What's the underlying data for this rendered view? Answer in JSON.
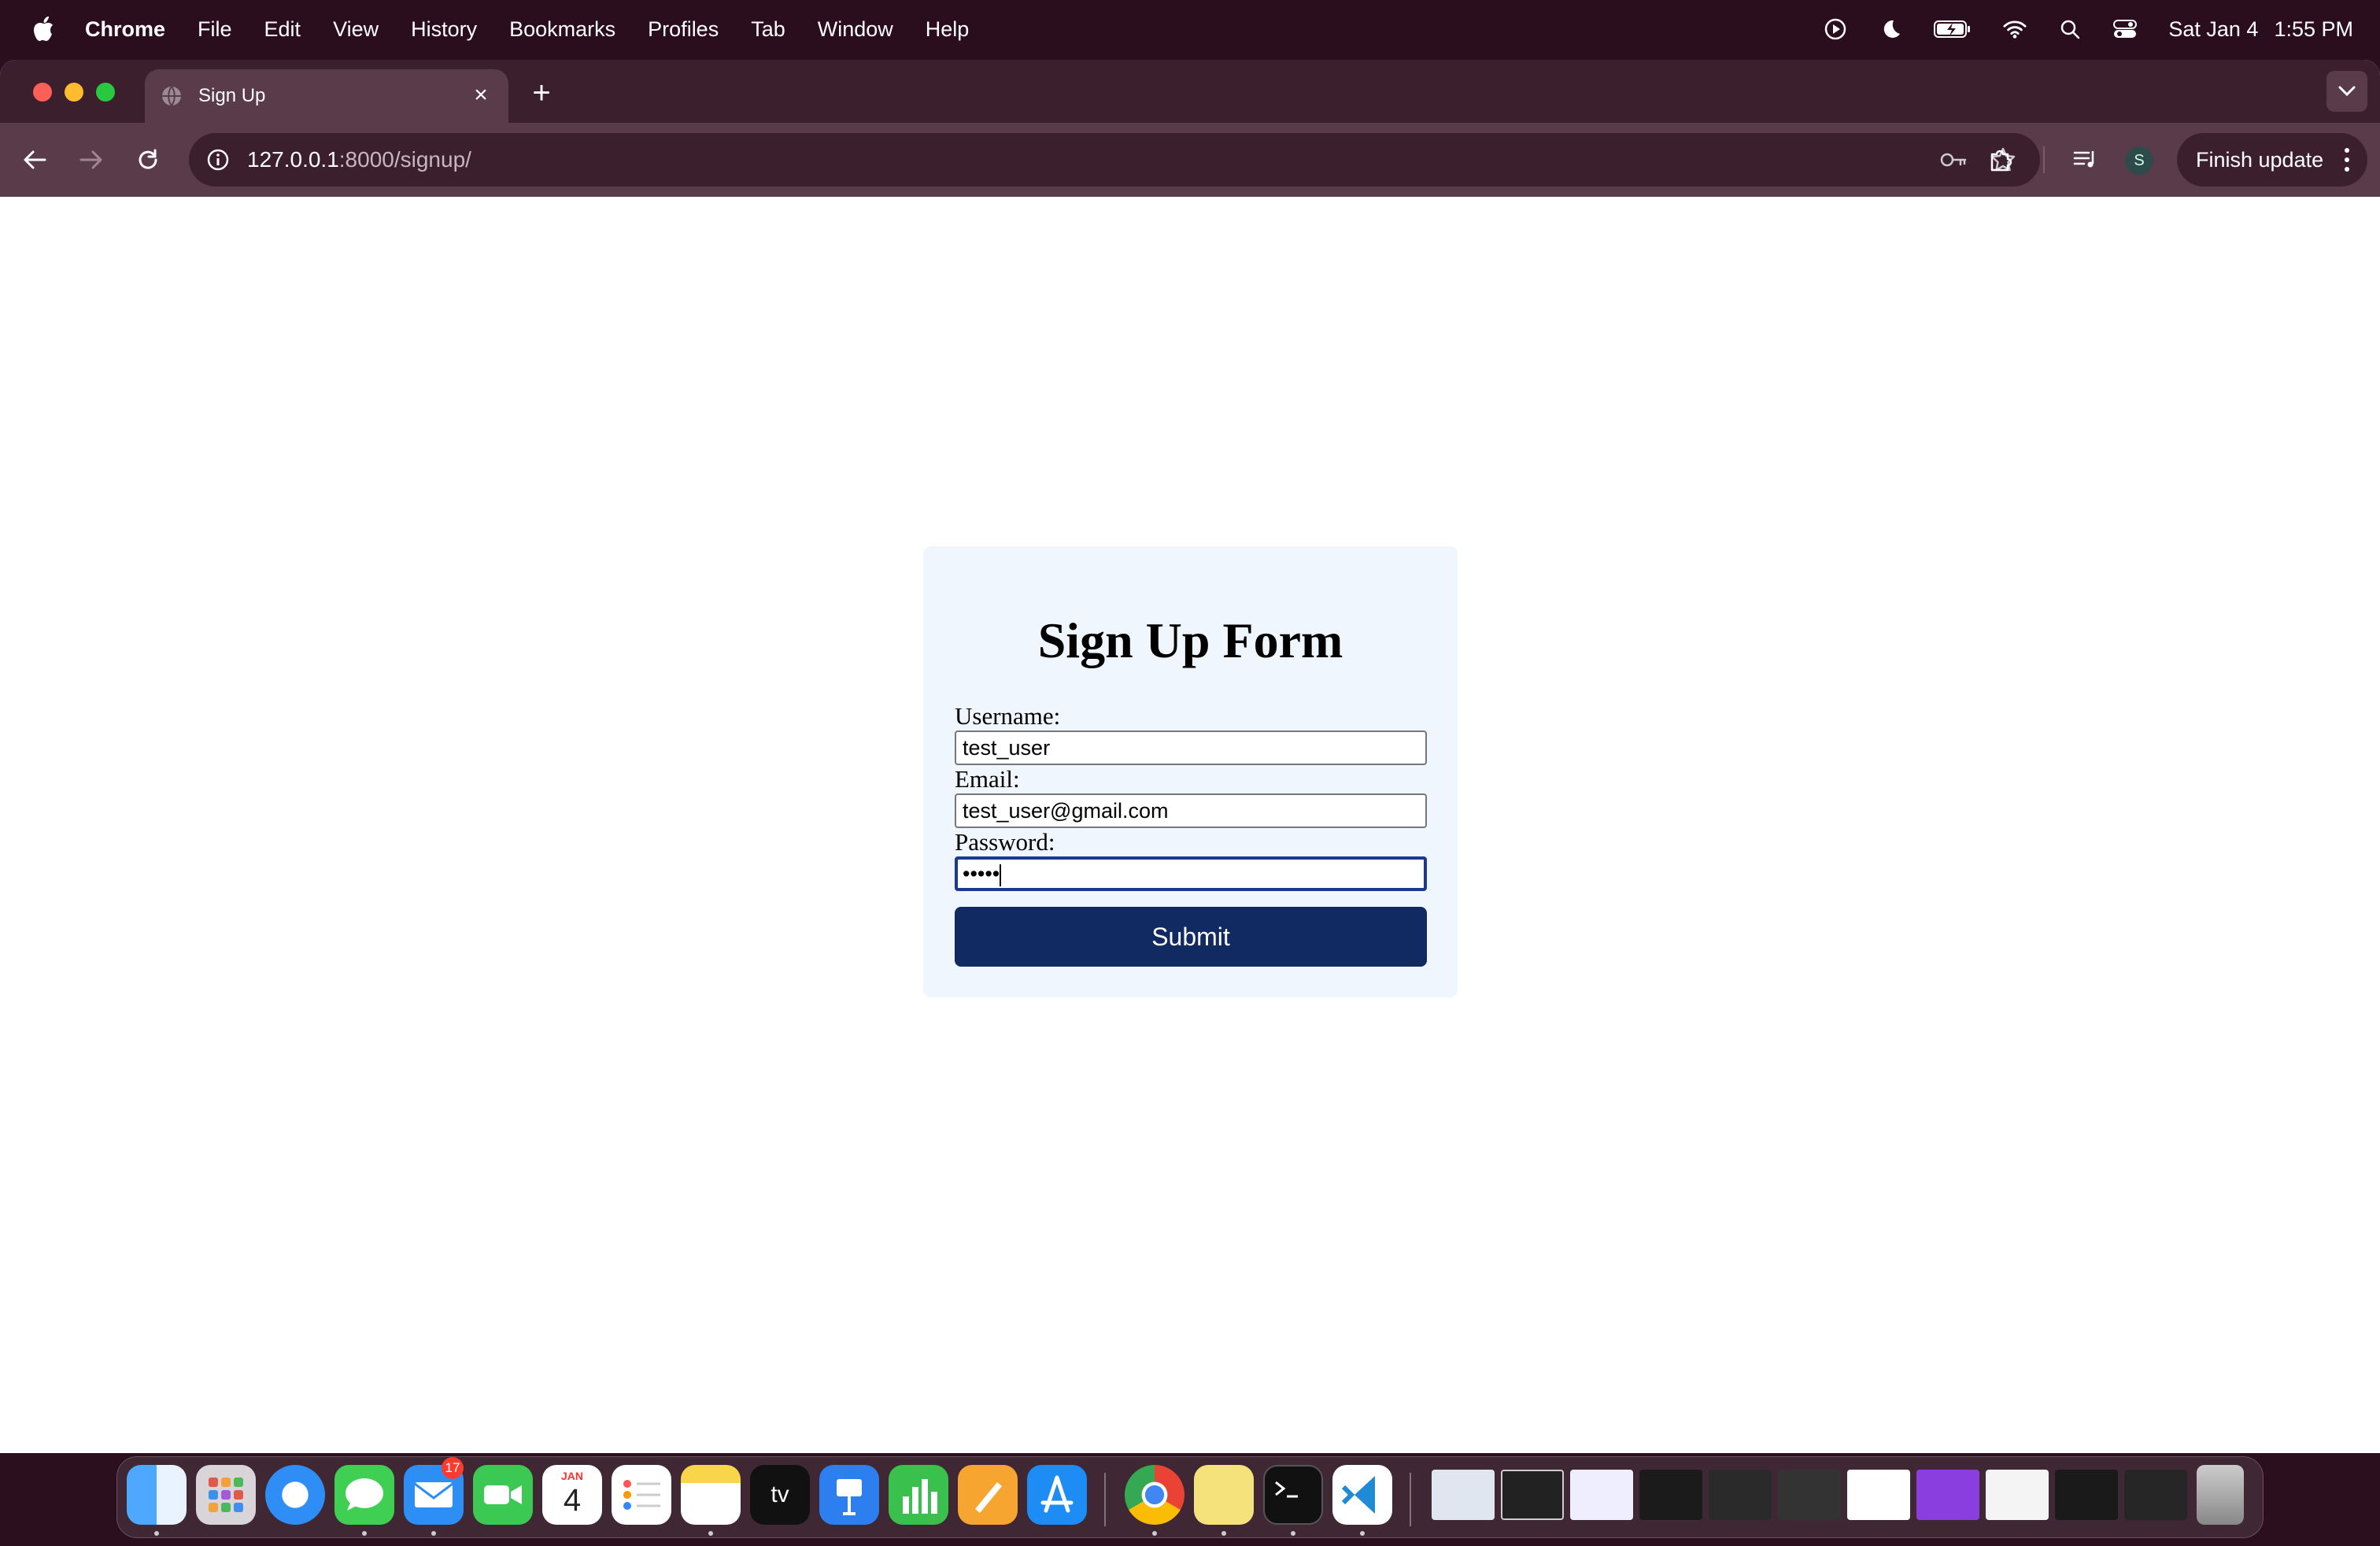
{
  "menubar": {
    "app_name": "Chrome",
    "items": [
      "File",
      "Edit",
      "View",
      "History",
      "Bookmarks",
      "Profiles",
      "Tab",
      "Window",
      "Help"
    ],
    "date": "Sat Jan 4",
    "time": "1:55 PM"
  },
  "browser": {
    "tab_title": "Sign Up",
    "url_host": "127.0.0.1",
    "url_path": ":8000/signup/",
    "profile_initial": "S",
    "finish_update_label": "Finish update"
  },
  "form": {
    "title": "Sign Up Form",
    "username_label": "Username:",
    "username_value": "test_user",
    "email_label": "Email:",
    "email_value": "test_user@gmail.com",
    "password_label": "Password:",
    "password_masked": "•••••",
    "submit_label": "Submit"
  },
  "dock": {
    "calendar_month": "JAN",
    "calendar_day": "4",
    "mail_badge": "17",
    "tv_label": "tv"
  },
  "colors": {
    "submit_bg": "#112a62",
    "card_bg": "#f0f6fd",
    "tab_active": "#5a3b4a",
    "titlebar": "#3b1f2d"
  }
}
